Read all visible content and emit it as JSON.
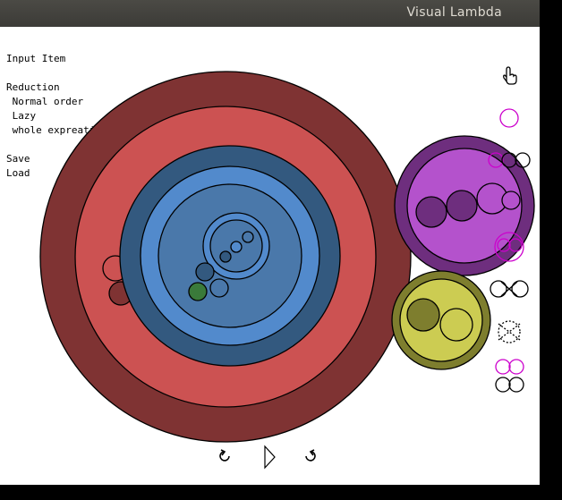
{
  "window": {
    "title": "Visual Lambda"
  },
  "menu": {
    "input_item": "Input Item",
    "reduction": "Reduction",
    "normal_order": " Normal order",
    "lazy": " Lazy",
    "whole_expression": " whole expreation",
    "save": "Save",
    "load": "Load"
  },
  "toolbar": {
    "undo_icon": "undo-arrow",
    "play_icon": "play-triangle",
    "redo_icon": "redo-arrow"
  },
  "palette": {
    "items": [
      "hand-cursor-icon",
      "single-bubble-icon",
      "pair-bubble-icon",
      "overlap-bubble-icon",
      "crossed-bubble-icon",
      "dashed-crossed-bubble-icon",
      "stacked-bubble-icon"
    ]
  },
  "colors": {
    "dark_red": "#7f3333",
    "red": "#cc5252",
    "dark_blue": "#33597f",
    "blue": "#528acc",
    "mid_blue": "#4a78aa",
    "purple": "#6e2e7e",
    "violet": "#b452cc",
    "olive": "#7e7e2e",
    "yellow": "#cccc52",
    "green": "#3a7a3a",
    "magenta": "#cc00cc"
  }
}
